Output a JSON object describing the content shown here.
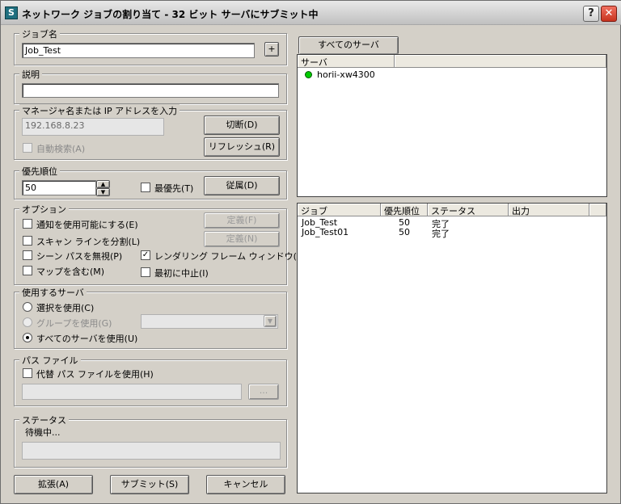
{
  "window": {
    "title": "ネットワーク ジョブの割り当て - 32 ビット サーバにサブミット中",
    "icon": "3ds-max-icon",
    "help_label": "?",
    "close_label": "✕"
  },
  "job_name": {
    "legend": "ジョブ名",
    "value": "Job_Test",
    "plus_label": "+"
  },
  "description": {
    "legend": "説明",
    "value": ""
  },
  "manager": {
    "legend": "マネージャ名または IP アドレスを入力",
    "value": "192.168.8.23",
    "disconnect_label": "切断(D)",
    "refresh_label": "リフレッシュ(R)",
    "auto_search_label": "自動検索(A)"
  },
  "priority": {
    "legend": "優先順位",
    "value": "50",
    "highest_label": "最優先(T)",
    "dependency_label": "従属(D)"
  },
  "options": {
    "legend": "オプション",
    "notify_label": "通知を使用可能にする(E)",
    "split_scan_label": "スキャン ラインを分割(L)",
    "ignore_scene_path_label": "シーン パスを無視(P)",
    "include_maps_label": "マップを含む(M)",
    "rendering_frame_window_label": "レンダリング フレーム ウィンドウ(R)",
    "stop_first_label": "最初に中止(I)",
    "define_f_label": "定義(F)",
    "define_n_label": "定義(N)",
    "rendering_frame_window_checked": true
  },
  "servers": {
    "legend": "使用するサーバ",
    "use_selected_label": "選択を使用(C)",
    "use_group_label": "グループを使用(G)",
    "use_all_label": "すべてのサーバを使用(U)",
    "selected_option": "use_all"
  },
  "path_file": {
    "legend": "パス ファイル",
    "alt_path_label": "代替 パス ファイルを使用(H)",
    "value": "",
    "browse_label": "..."
  },
  "status": {
    "legend": "ステータス",
    "text": "待機中..."
  },
  "buttons": {
    "expand_label": "拡張(A)",
    "submit_label": "サブミット(S)",
    "cancel_label": "キャンセル"
  },
  "server_panel": {
    "tab_label": "すべてのサーバ",
    "column_header": "サーバ",
    "servers": [
      {
        "name": "horii-xw4300",
        "status_color": "#00cc00"
      }
    ]
  },
  "job_panel": {
    "headers": [
      "ジョブ",
      "優先順位",
      "ステータス",
      "出力"
    ],
    "rows": [
      {
        "job": "Job_Test",
        "priority": "50",
        "status": "完了",
        "output": ""
      },
      {
        "job": "Job_Test01",
        "priority": "50",
        "status": "完了",
        "output": ""
      }
    ]
  }
}
